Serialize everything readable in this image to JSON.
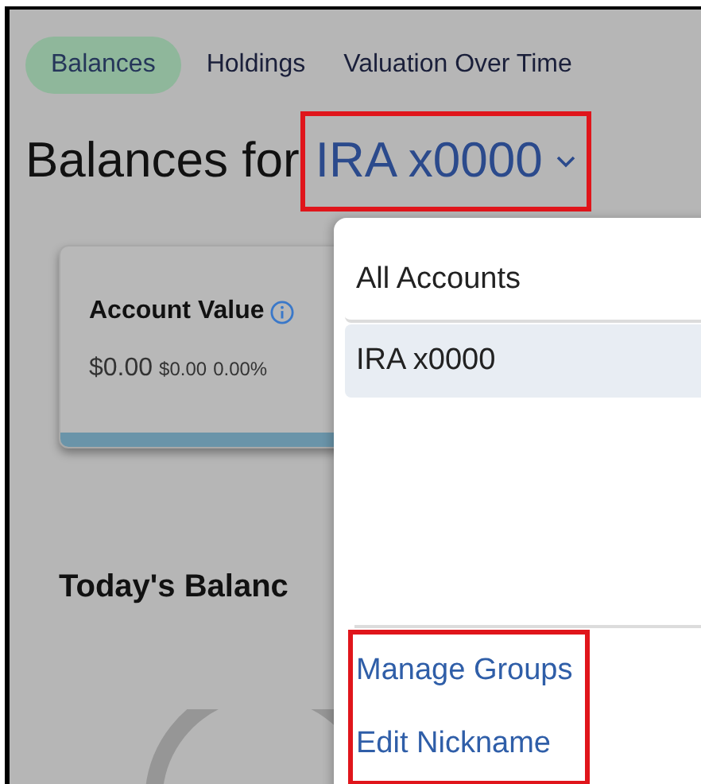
{
  "tabs": [
    {
      "label": "Balances",
      "selected": true
    },
    {
      "label": "Holdings",
      "selected": false
    },
    {
      "label": "Valuation Over Time",
      "selected": false
    }
  ],
  "heading": {
    "text": "Balances for",
    "account": "IRA x0000",
    "highlighted": true
  },
  "account_card": {
    "title": "Account Value",
    "value": "$0.00",
    "change": "$0.00",
    "change_percent": "0.00%"
  },
  "section_title": "Today's Balanc",
  "dropdown": {
    "items": [
      {
        "label": "All Accounts",
        "selected": false
      },
      {
        "label": "IRA x0000",
        "selected": true
      }
    ],
    "links": [
      "Manage Groups",
      "Edit Nickname"
    ],
    "links_highlighted": true
  }
}
